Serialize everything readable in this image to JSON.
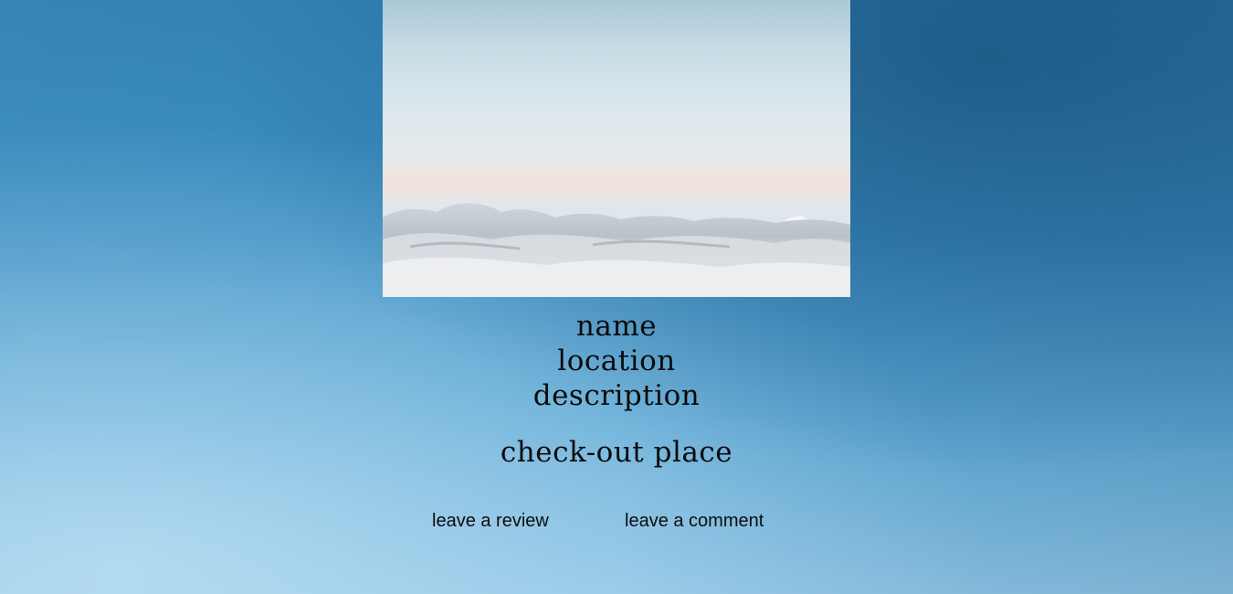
{
  "place": {
    "name": "name",
    "location": "location",
    "description": "description"
  },
  "heading": "check-out place",
  "actions": {
    "review_label": "leave a review",
    "comment_label": "leave a comment"
  },
  "colors": {
    "background_blue": "#3a8ec2",
    "text": "#0b0b0b"
  }
}
